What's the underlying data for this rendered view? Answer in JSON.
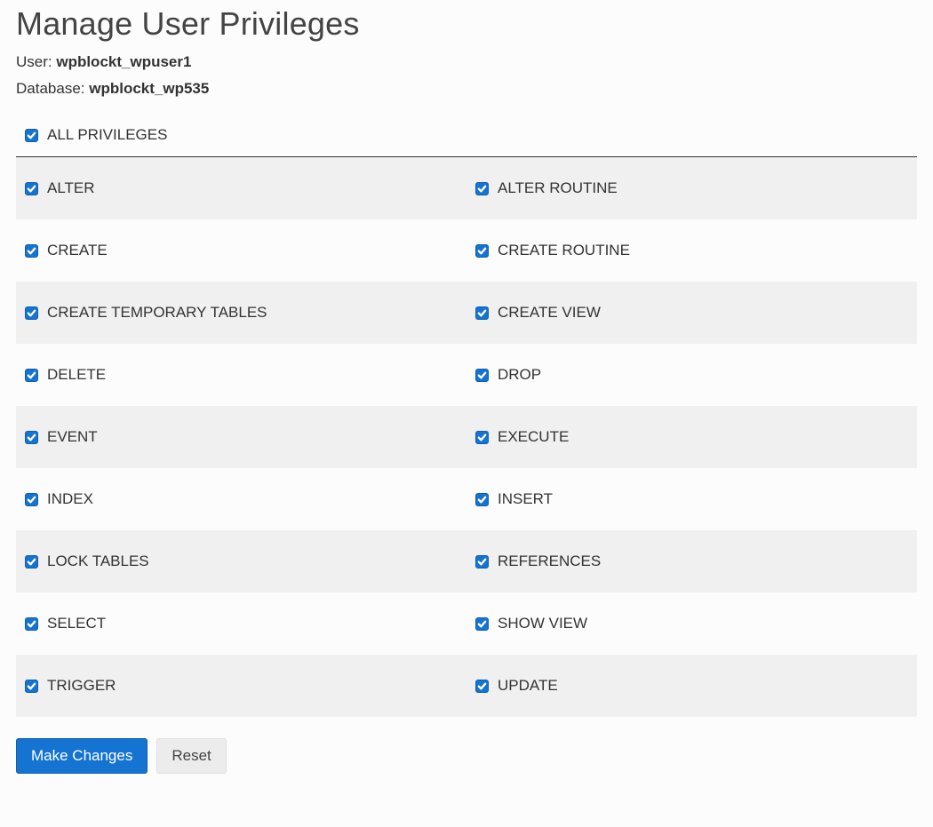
{
  "title": "Manage User Privileges",
  "user_label": "User: ",
  "user_value": "wpblockt_wpuser1",
  "db_label": "Database: ",
  "db_value": "wpblockt_wp535",
  "all_privileges": {
    "label": "ALL PRIVILEGES",
    "checked": true
  },
  "privileges": [
    {
      "left": {
        "label": "ALTER",
        "checked": true
      },
      "right": {
        "label": "ALTER ROUTINE",
        "checked": true
      }
    },
    {
      "left": {
        "label": "CREATE",
        "checked": true
      },
      "right": {
        "label": "CREATE ROUTINE",
        "checked": true
      }
    },
    {
      "left": {
        "label": "CREATE TEMPORARY TABLES",
        "checked": true
      },
      "right": {
        "label": "CREATE VIEW",
        "checked": true
      }
    },
    {
      "left": {
        "label": "DELETE",
        "checked": true
      },
      "right": {
        "label": "DROP",
        "checked": true
      }
    },
    {
      "left": {
        "label": "EVENT",
        "checked": true
      },
      "right": {
        "label": "EXECUTE",
        "checked": true
      }
    },
    {
      "left": {
        "label": "INDEX",
        "checked": true
      },
      "right": {
        "label": "INSERT",
        "checked": true
      }
    },
    {
      "left": {
        "label": "LOCK TABLES",
        "checked": true
      },
      "right": {
        "label": "REFERENCES",
        "checked": true
      }
    },
    {
      "left": {
        "label": "SELECT",
        "checked": true
      },
      "right": {
        "label": "SHOW VIEW",
        "checked": true
      }
    },
    {
      "left": {
        "label": "TRIGGER",
        "checked": true
      },
      "right": {
        "label": "UPDATE",
        "checked": true
      }
    }
  ],
  "buttons": {
    "make_changes": "Make Changes",
    "reset": "Reset"
  }
}
